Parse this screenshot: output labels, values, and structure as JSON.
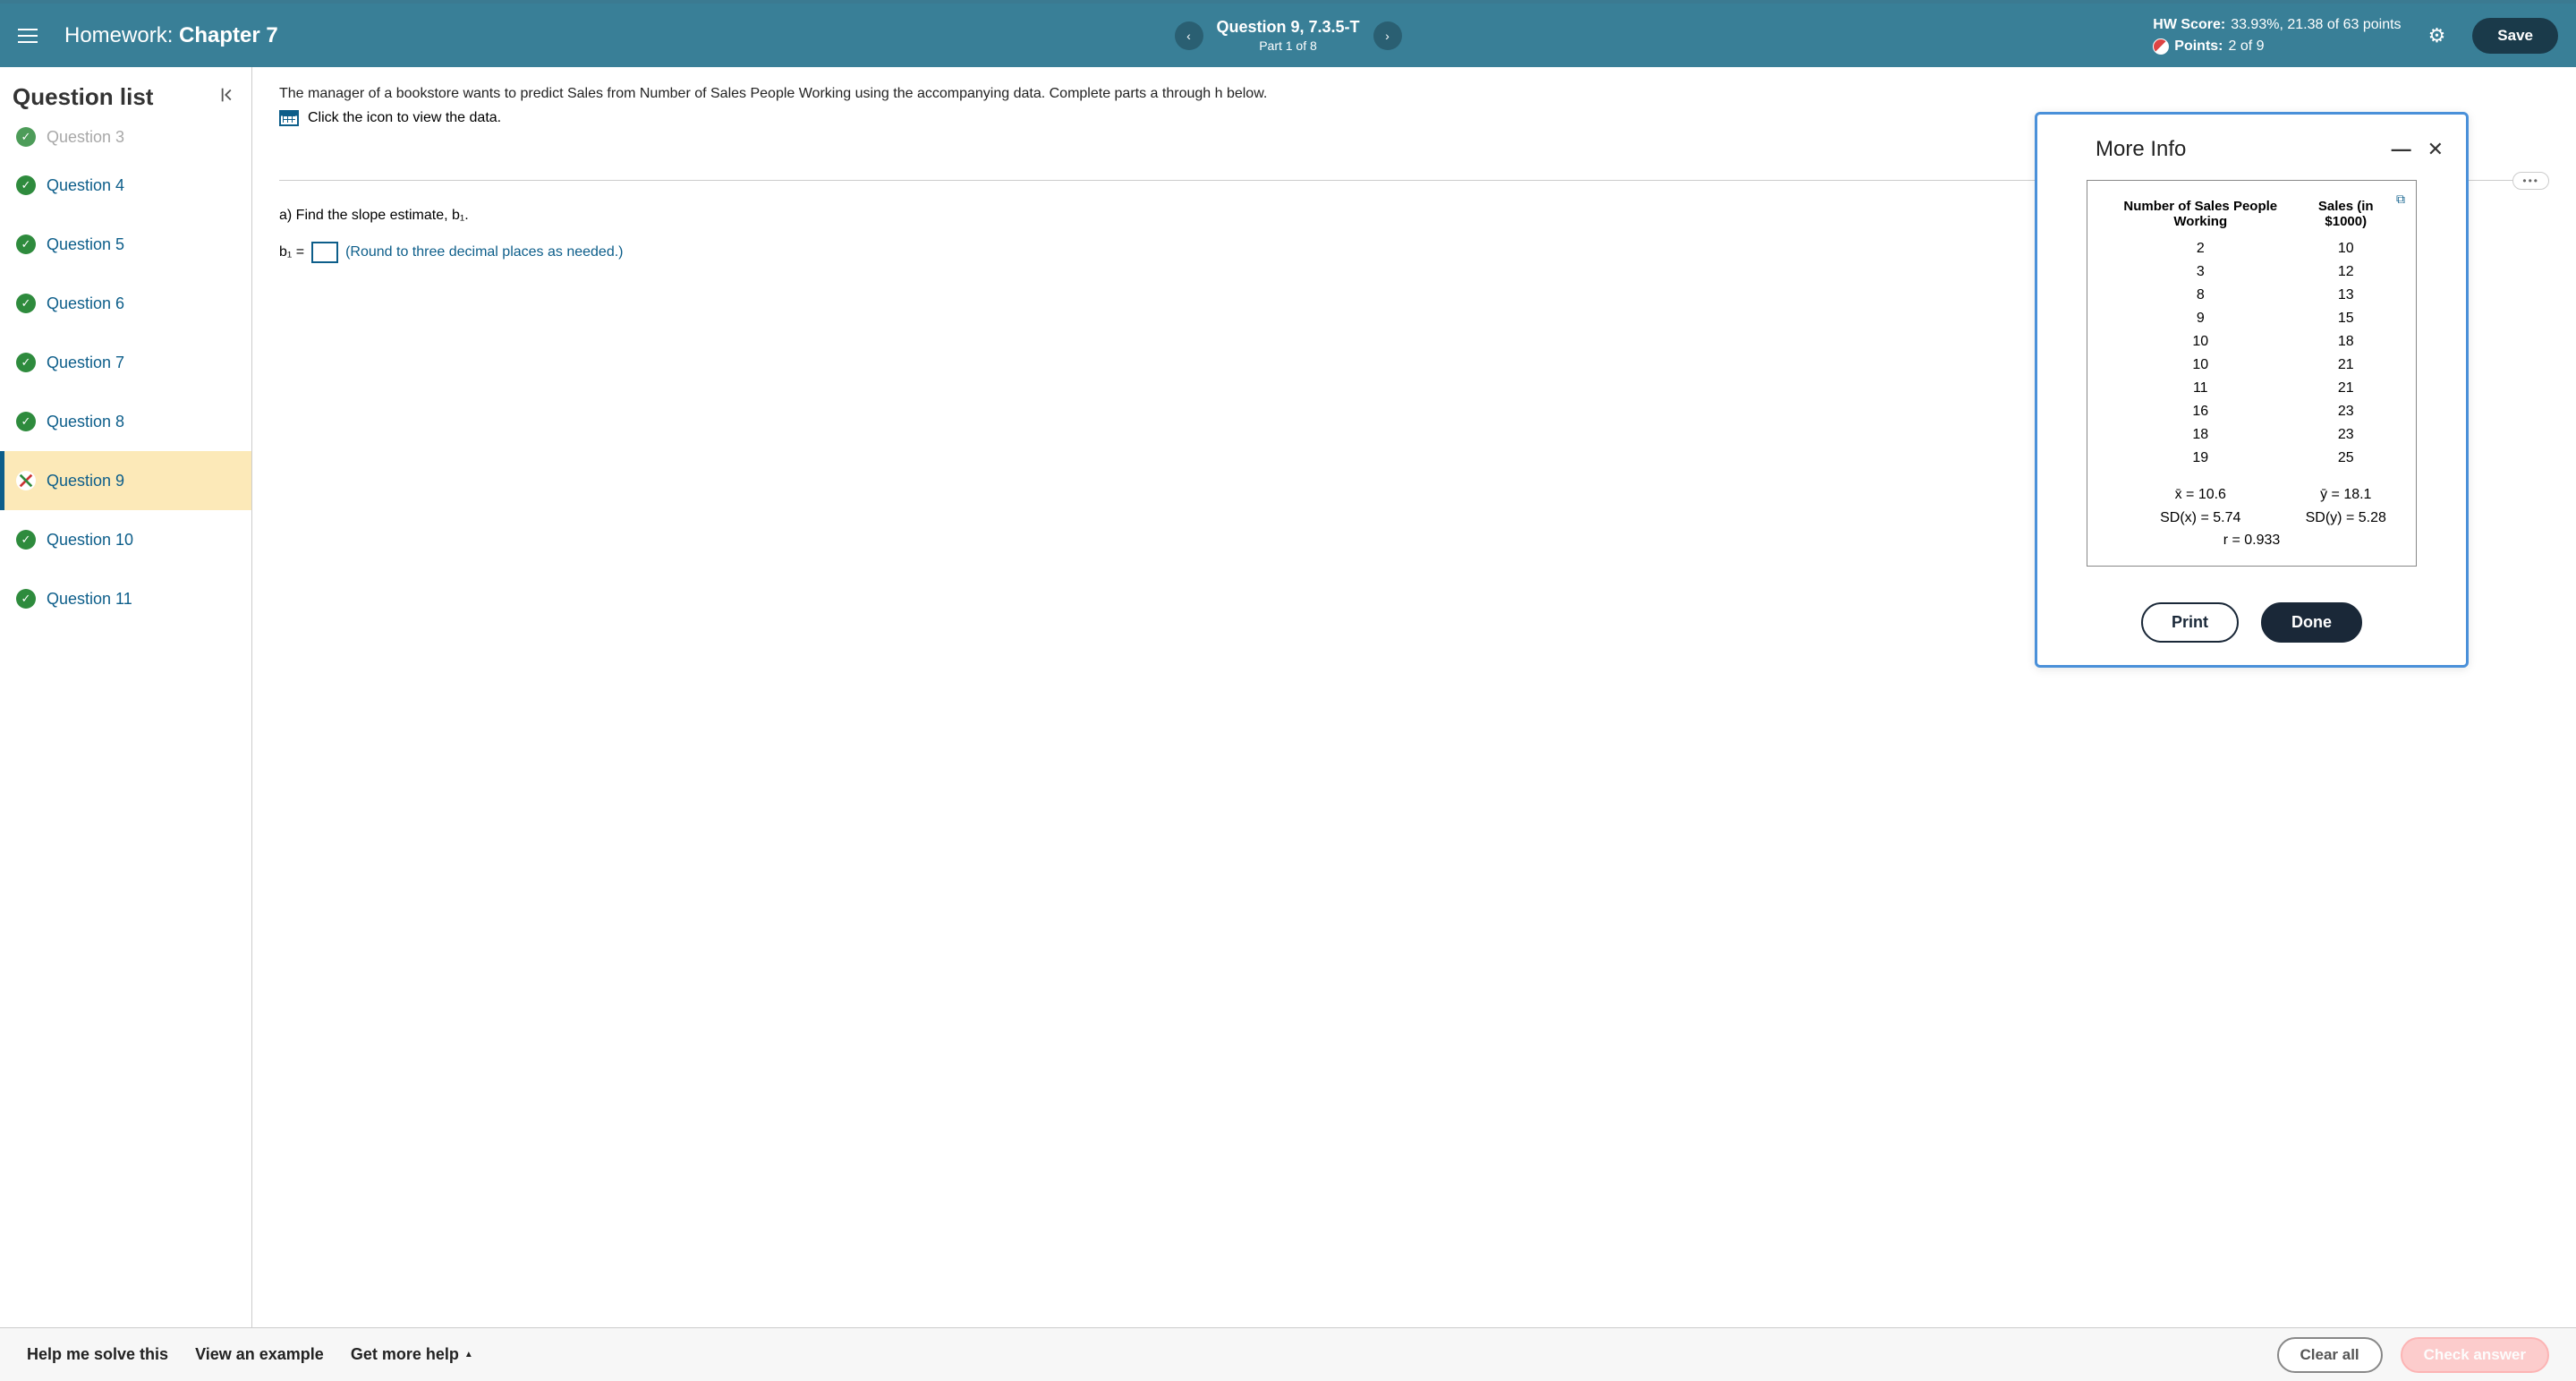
{
  "header": {
    "hw_prefix": "Homework:",
    "hw_title": "Chapter 7",
    "question_label": "Question 9, 7.3.5-T",
    "part_label": "Part 1 of 8",
    "hw_score_label": "HW Score:",
    "hw_score_value": "33.93%, 21.38 of 63 points",
    "points_label": "Points:",
    "points_value": "2 of 9",
    "save": "Save"
  },
  "sidebar": {
    "title": "Question list",
    "items": [
      {
        "label": "Question 3",
        "status": "correct",
        "cut": true
      },
      {
        "label": "Question 4",
        "status": "correct"
      },
      {
        "label": "Question 5",
        "status": "correct"
      },
      {
        "label": "Question 6",
        "status": "correct"
      },
      {
        "label": "Question 7",
        "status": "correct"
      },
      {
        "label": "Question 8",
        "status": "correct"
      },
      {
        "label": "Question 9",
        "status": "partial",
        "active": true
      },
      {
        "label": "Question 10",
        "status": "correct"
      },
      {
        "label": "Question 11",
        "status": "correct"
      }
    ]
  },
  "content": {
    "prompt": "The manager of a bookstore wants to predict Sales from Number of Sales People Working using the accompanying data. Complete parts a through h below.",
    "data_link": "Click the icon to view the data.",
    "part_a": "a) Find the slope estimate, b₁.",
    "b1_prefix": "b₁ =",
    "hint": "(Round to three decimal places as needed.)"
  },
  "modal": {
    "title": "More Info",
    "col1": "Number of Sales People Working",
    "col2": "Sales (in $1000)",
    "rows": [
      {
        "x": "2",
        "y": "10"
      },
      {
        "x": "3",
        "y": "12"
      },
      {
        "x": "8",
        "y": "13"
      },
      {
        "x": "9",
        "y": "15"
      },
      {
        "x": "10",
        "y": "18"
      },
      {
        "x": "10",
        "y": "21"
      },
      {
        "x": "11",
        "y": "21"
      },
      {
        "x": "16",
        "y": "23"
      },
      {
        "x": "18",
        "y": "23"
      },
      {
        "x": "19",
        "y": "25"
      }
    ],
    "xbar": "x̄ = 10.6",
    "ybar": "ȳ = 18.1",
    "sdx": "SD(x) = 5.74",
    "sdy": "SD(y) = 5.28",
    "r": "r = 0.933",
    "print": "Print",
    "done": "Done"
  },
  "footer": {
    "help": "Help me solve this",
    "example": "View an example",
    "more": "Get more help",
    "clear": "Clear all",
    "check": "Check answer"
  }
}
